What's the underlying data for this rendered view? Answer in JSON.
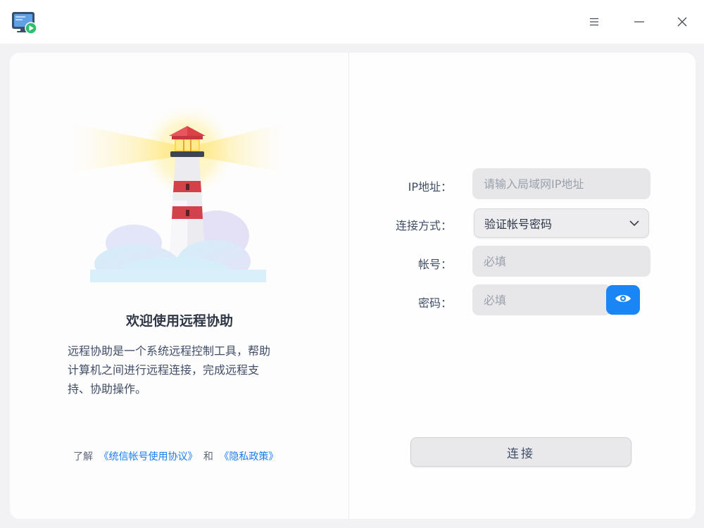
{
  "titlebar": {
    "app_icon": "remote-assistance-icon",
    "menu_icon": "hamburger-menu-icon",
    "minimize_icon": "minimize-icon",
    "close_icon": "close-icon"
  },
  "welcome": {
    "title": "欢迎使用远程协助",
    "desc_line1": "远程协助是一个系统远程控制工具，帮助",
    "desc_line2": "计算机之间进行远程连接，完成远程支",
    "desc_line3": "持、协助操作。"
  },
  "footer": {
    "prefix": "了解",
    "agreement_link": "《统信帐号使用协议》",
    "and": "和",
    "privacy_link": "《隐私政策》"
  },
  "form": {
    "ip_label": "IP地址：",
    "ip_placeholder": "请输入局域网IP地址",
    "method_label": "连接方式：",
    "method_value": "验证帐号密码",
    "account_label": "帐号：",
    "account_placeholder": "必填",
    "password_label": "密码：",
    "password_placeholder": "必填",
    "eye_icon": "eye-icon",
    "connect_label": "连接"
  },
  "colors": {
    "accent": "#1a85f5",
    "link": "#1c7cf0",
    "window_bg": "#f2f2f4"
  }
}
